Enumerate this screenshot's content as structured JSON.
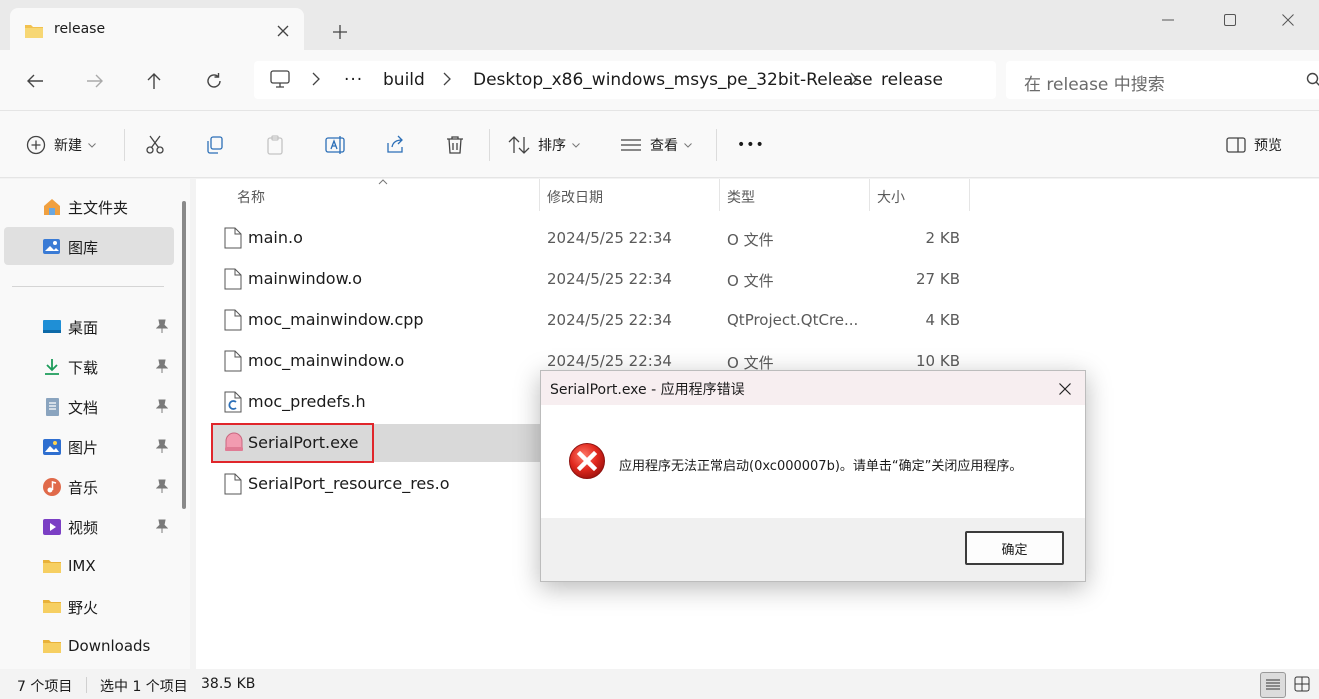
{
  "window": {
    "tab_title": "release",
    "tab_icon": "folder-icon",
    "controls": [
      "minimize-icon",
      "maximize-icon",
      "close-icon"
    ]
  },
  "address": {
    "crumbs": [
      "build",
      "Desktop_x86_windows_msys_pe_32bit-Release",
      "release"
    ],
    "overflow": "···",
    "search_placeholder": "在 release 中搜索"
  },
  "commands": {
    "new_label": "新建",
    "sort_label": "排序",
    "view_label": "查看",
    "more": "•••",
    "preview_label": "预览"
  },
  "sidebar": {
    "items": [
      {
        "label": "主文件夹",
        "icon": "home-icon"
      },
      {
        "label": "图库",
        "icon": "gallery-icon"
      },
      {
        "label": "桌面",
        "icon": "desktop-icon"
      },
      {
        "label": "下载",
        "icon": "download-icon"
      },
      {
        "label": "文档",
        "icon": "document-icon"
      },
      {
        "label": "图片",
        "icon": "pictures-icon"
      },
      {
        "label": "音乐",
        "icon": "music-icon"
      },
      {
        "label": "视频",
        "icon": "video-icon"
      },
      {
        "label": "IMX",
        "icon": "folder-icon"
      },
      {
        "label": "野火",
        "icon": "folder-icon"
      },
      {
        "label": "Downloads",
        "icon": "folder-icon"
      }
    ]
  },
  "columns": {
    "name": "名称",
    "date": "修改日期",
    "type": "类型",
    "size": "大小"
  },
  "files": [
    {
      "name": "main.o",
      "date": "2024/5/25 22:34",
      "type": "O 文件",
      "size": "2 KB"
    },
    {
      "name": "mainwindow.o",
      "date": "2024/5/25 22:34",
      "type": "O 文件",
      "size": "27 KB"
    },
    {
      "name": "moc_mainwindow.cpp",
      "date": "2024/5/25 22:34",
      "type": "QtProject.QtCre...",
      "size": "4 KB"
    },
    {
      "name": "moc_mainwindow.o",
      "date": "2024/5/25 22:34",
      "type": "O 文件",
      "size": "10 KB"
    },
    {
      "name": "moc_predefs.h",
      "date": "",
      "type": "",
      "size": ""
    },
    {
      "name": "SerialPort.exe",
      "date": "",
      "type": "",
      "size": ""
    },
    {
      "name": "SerialPort_resource_res.o",
      "date": "",
      "type": "",
      "size": ""
    }
  ],
  "status": {
    "count": "7 个项目",
    "selection": "选中 1 个项目",
    "selection_size": "38.5 KB"
  },
  "dialog": {
    "title": "SerialPort.exe - 应用程序错误",
    "message": "应用程序无法正常启动(0xc000007b)。请单击“确定”关闭应用程序。",
    "ok_label": "确定",
    "icon": "error-icon"
  }
}
